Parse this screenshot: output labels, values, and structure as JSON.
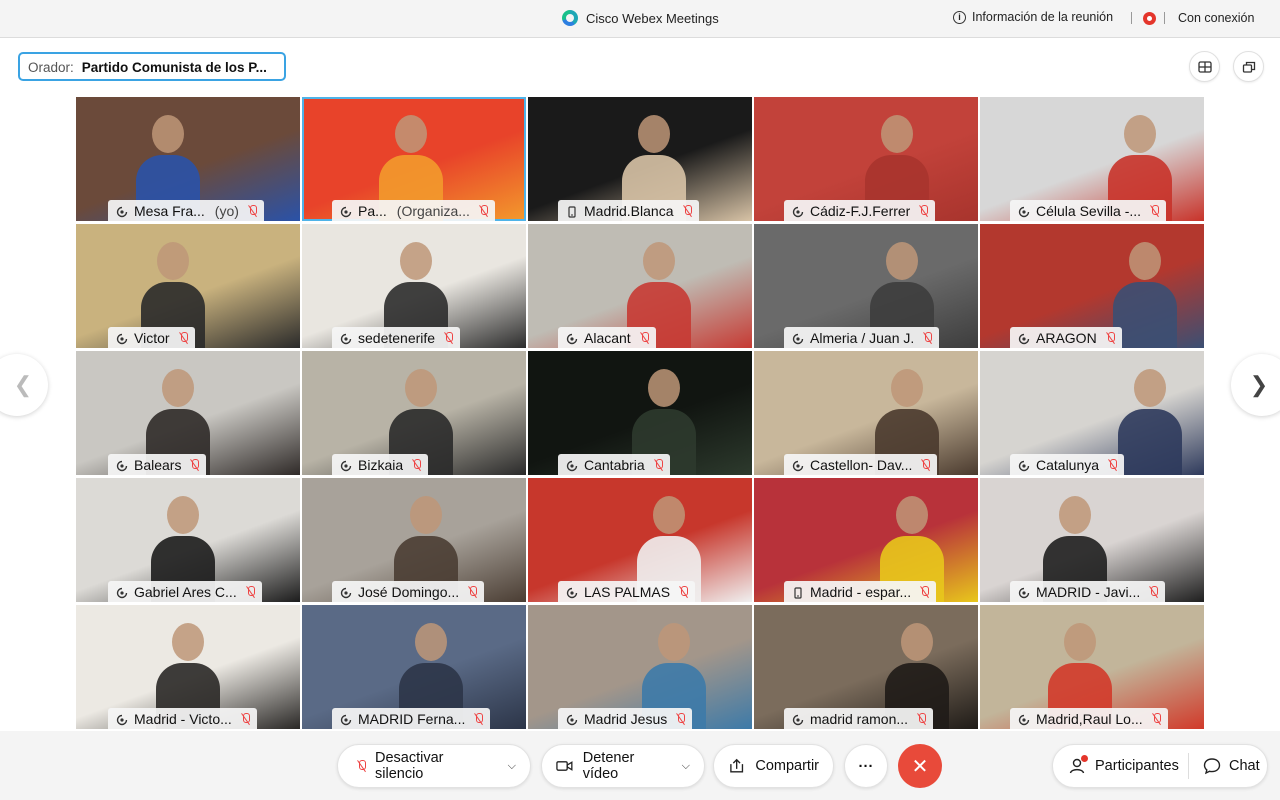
{
  "window": {
    "title": "Cisco Webex Meetings",
    "meeting_info": "Información de la reunión",
    "connection_status": "Con conexión"
  },
  "speaker": {
    "label": "Orador:",
    "name": "Partido Comunista de los P..."
  },
  "participants": [
    {
      "name": "Mesa Fra...",
      "suffix": "(yo)",
      "bg": "#6b4a3a",
      "accent": "#2a52a8",
      "icon": "network-icon"
    },
    {
      "name": "Pa...",
      "suffix": "(Organiza...",
      "bg": "#e8432a",
      "accent": "#f39a2c",
      "icon": "network-icon",
      "active": true
    },
    {
      "name": "Madrid.Blanca",
      "suffix": "",
      "bg": "#1a1a1a",
      "accent": "#d8c3a6",
      "icon": "phone-icon"
    },
    {
      "name": "Cádiz-F.J.Ferrer",
      "suffix": "",
      "bg": "#c2423a",
      "accent": "#a8342d",
      "icon": "network-icon"
    },
    {
      "name": "Célula Sevilla -...",
      "suffix": "",
      "bg": "#d7d7d7",
      "accent": "#c8332a",
      "icon": "network-icon"
    },
    {
      "name": "Victor",
      "suffix": "",
      "bg": "#c9b27e",
      "accent": "#2a2a2a",
      "icon": "network-icon"
    },
    {
      "name": "sedetenerife",
      "suffix": "",
      "bg": "#e9e6e0",
      "accent": "#2c2c2c",
      "icon": "network-icon"
    },
    {
      "name": "Alacant",
      "suffix": "",
      "bg": "#bfbcb4",
      "accent": "#c63a33",
      "icon": "network-icon"
    },
    {
      "name": "Almeria / Juan J.",
      "suffix": "",
      "bg": "#6a6a6a",
      "accent": "#3d3d3d",
      "icon": "network-icon"
    },
    {
      "name": "ARAGON",
      "suffix": "",
      "bg": "#b3382e",
      "accent": "#3b4f73",
      "icon": "network-icon"
    },
    {
      "name": "Balears",
      "suffix": "",
      "bg": "#c9c7c2",
      "accent": "#2f2a28",
      "icon": "network-icon"
    },
    {
      "name": "Bizkaia",
      "suffix": "",
      "bg": "#b8b3a6",
      "accent": "#2a2a2a",
      "icon": "network-icon"
    },
    {
      "name": "Cantabria",
      "suffix": "",
      "bg": "#111511",
      "accent": "#2d3a2d",
      "icon": "network-icon"
    },
    {
      "name": "Castellon- Dav...",
      "suffix": "",
      "bg": "#c8b79b",
      "accent": "#4a3a2e",
      "icon": "network-icon"
    },
    {
      "name": "Catalunya",
      "suffix": "",
      "bg": "#d6d4d0",
      "accent": "#2e3a5c",
      "icon": "network-icon"
    },
    {
      "name": "Gabriel Ares C...",
      "suffix": "",
      "bg": "#dcdad6",
      "accent": "#1c1c1c",
      "icon": "network-icon"
    },
    {
      "name": "José Domingo...",
      "suffix": "",
      "bg": "#a8a29a",
      "accent": "#4a3d33",
      "icon": "network-icon"
    },
    {
      "name": "LAS PALMAS",
      "suffix": "",
      "bg": "#c7372c",
      "accent": "#f0f0f0",
      "icon": "network-icon"
    },
    {
      "name": "Madrid - espar...",
      "suffix": "",
      "bg": "#b8323a",
      "accent": "#e8c71c",
      "icon": "phone-icon"
    },
    {
      "name": "MADRID - Javi...",
      "suffix": "",
      "bg": "#d9d4d2",
      "accent": "#1f1f1f",
      "icon": "network-icon"
    },
    {
      "name": "Madrid - Victo...",
      "suffix": "",
      "bg": "#ece9e3",
      "accent": "#2a2826",
      "icon": "network-icon"
    },
    {
      "name": "MADRID Ferna...",
      "suffix": "",
      "bg": "#5a6a86",
      "accent": "#2c3548",
      "icon": "network-icon"
    },
    {
      "name": "Madrid Jesus",
      "suffix": "",
      "bg": "#a3968a",
      "accent": "#3d7aa8",
      "icon": "network-icon"
    },
    {
      "name": "madrid ramon...",
      "suffix": "",
      "bg": "#7b6c5c",
      "accent": "#1f1b17",
      "icon": "network-icon"
    },
    {
      "name": "Madrid,Raul Lo...",
      "suffix": "",
      "bg": "#c2b59a",
      "accent": "#d13a2a",
      "icon": "network-icon"
    }
  ],
  "toolbar": {
    "mute_label": "Desactivar silencio",
    "video_label": "Detener vídeo",
    "share_label": "Compartir",
    "more_label": "...",
    "participants_label": "Participantes",
    "chat_label": "Chat"
  }
}
